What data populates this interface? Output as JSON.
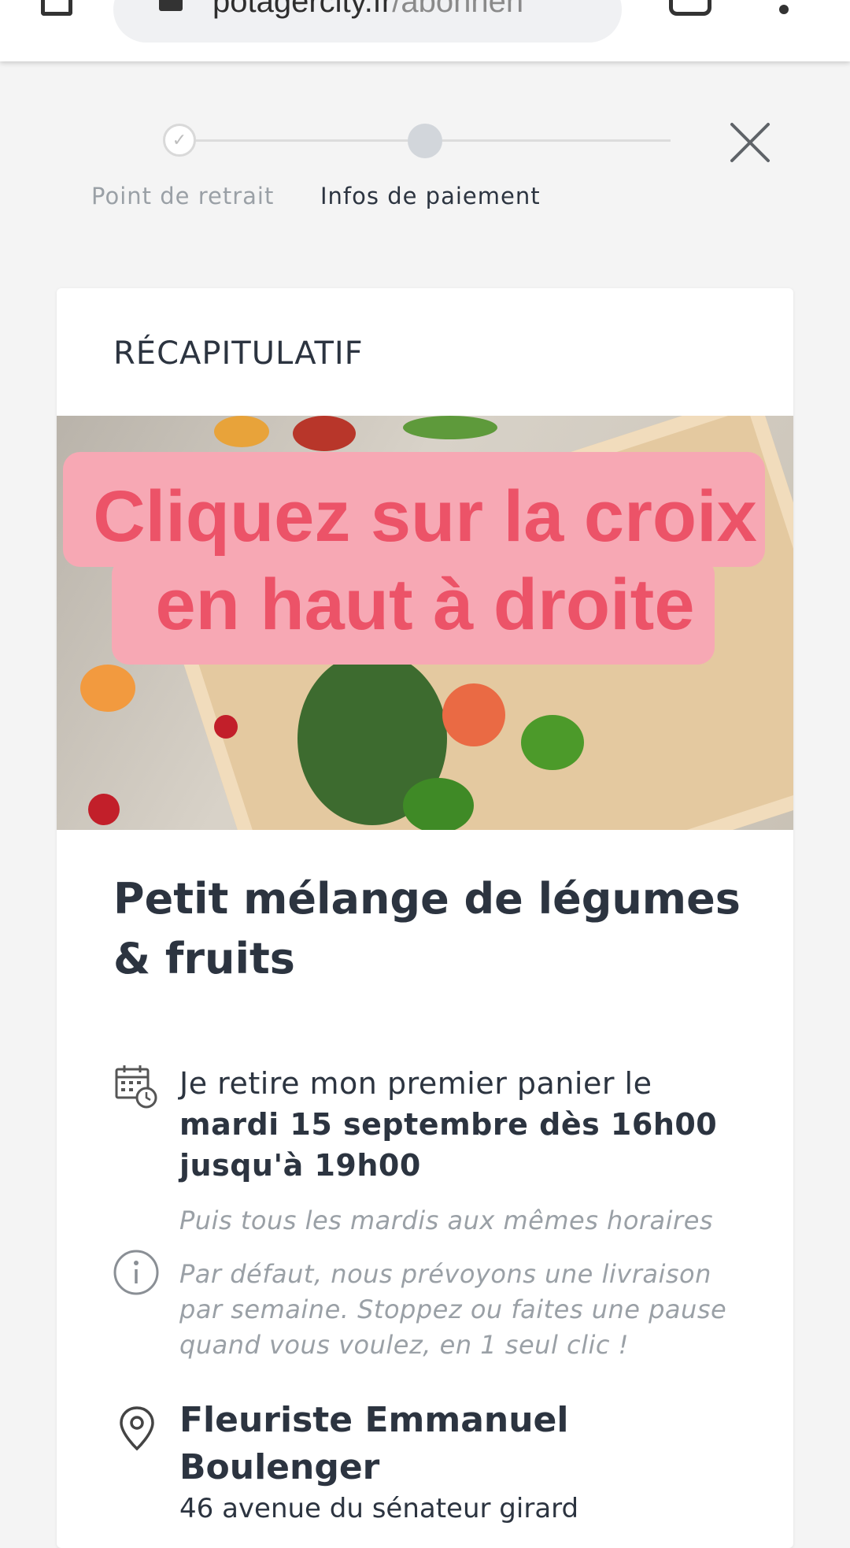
{
  "browser": {
    "url_domain": "potagercity.fr",
    "url_path": "/abonnen"
  },
  "stepper": {
    "steps": [
      {
        "label": "Point de retrait",
        "state": "done"
      },
      {
        "label": "Infos de paiement",
        "state": "active"
      }
    ]
  },
  "card": {
    "title": "RÉCAPITULATIF",
    "overlay_text_line1": "Cliquez sur la croix",
    "overlay_text_line2": "en haut à droite",
    "product_name": "Petit mélange de légumes & fruits",
    "pickup_prefix": "Je retire mon premier panier le",
    "pickup_date": "mardi 15 septembre dès 16h00 jusqu'à 19h00",
    "pickup_recurrence": "Puis tous les mardis aux mêmes horaires",
    "info_note": "Par défaut, nous prévoyons une livraison par semaine. Stoppez ou faites une pause quand vous voulez, en 1 seul clic !",
    "location_name": "Fleuriste Emmanuel Boulenger",
    "location_address": "46 avenue du sénateur girard"
  },
  "colors": {
    "overlay_bg": "#f7a8b4",
    "overlay_text": "#ec5368",
    "text_primary": "#2c3440",
    "text_muted": "#9aa0a6"
  }
}
